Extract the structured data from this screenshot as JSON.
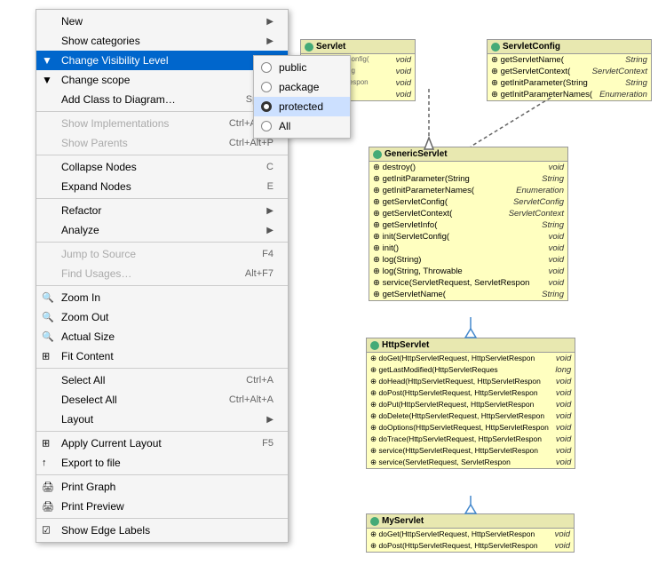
{
  "menu": {
    "items": [
      {
        "id": "new",
        "label": "New",
        "shortcut": "",
        "icon": "",
        "disabled": false,
        "hasArrow": true,
        "separator_after": false
      },
      {
        "id": "show-categories",
        "label": "Show categories",
        "shortcut": "",
        "icon": "",
        "disabled": false,
        "hasArrow": true,
        "separator_after": false
      },
      {
        "id": "change-visibility",
        "label": "Change Visibility Level",
        "shortcut": "",
        "icon": "🔽",
        "disabled": false,
        "hasArrow": true,
        "highlighted": true,
        "separator_after": false
      },
      {
        "id": "change-scope",
        "label": "Change scope",
        "shortcut": "",
        "icon": "🔽",
        "disabled": false,
        "hasArrow": true,
        "separator_after": false
      },
      {
        "id": "add-class",
        "label": "Add Class to Diagram…",
        "shortcut": "Space",
        "icon": "",
        "disabled": false,
        "hasArrow": false,
        "separator_after": true
      },
      {
        "id": "show-impl",
        "label": "Show Implementations",
        "shortcut": "Ctrl+Alt+B",
        "icon": "",
        "disabled": true,
        "hasArrow": false,
        "separator_after": false
      },
      {
        "id": "show-parents",
        "label": "Show Parents",
        "shortcut": "Ctrl+Alt+P",
        "icon": "",
        "disabled": true,
        "hasArrow": false,
        "separator_after": true
      },
      {
        "id": "collapse-nodes",
        "label": "Collapse Nodes",
        "shortcut": "C",
        "icon": "",
        "disabled": false,
        "hasArrow": false,
        "separator_after": false
      },
      {
        "id": "expand-nodes",
        "label": "Expand Nodes",
        "shortcut": "E",
        "icon": "",
        "disabled": false,
        "hasArrow": false,
        "separator_after": true
      },
      {
        "id": "refactor",
        "label": "Refactor",
        "shortcut": "",
        "icon": "",
        "disabled": false,
        "hasArrow": true,
        "separator_after": false
      },
      {
        "id": "analyze",
        "label": "Analyze",
        "shortcut": "",
        "icon": "",
        "disabled": false,
        "hasArrow": true,
        "separator_after": true
      },
      {
        "id": "jump-to-source",
        "label": "Jump to Source",
        "shortcut": "F4",
        "icon": "",
        "disabled": true,
        "hasArrow": false,
        "separator_after": false
      },
      {
        "id": "find-usages",
        "label": "Find Usages…",
        "shortcut": "Alt+F7",
        "icon": "",
        "disabled": true,
        "hasArrow": false,
        "separator_after": true
      },
      {
        "id": "zoom-in",
        "label": "Zoom In",
        "shortcut": "",
        "icon": "🔍",
        "disabled": false,
        "hasArrow": false,
        "separator_after": false
      },
      {
        "id": "zoom-out",
        "label": "Zoom Out",
        "shortcut": "",
        "icon": "🔍",
        "disabled": false,
        "hasArrow": false,
        "separator_after": false
      },
      {
        "id": "actual-size",
        "label": "Actual Size",
        "shortcut": "",
        "icon": "🔍",
        "disabled": false,
        "hasArrow": false,
        "separator_after": false
      },
      {
        "id": "fit-content",
        "label": "Fit Content",
        "shortcut": "",
        "icon": "⊞",
        "disabled": false,
        "hasArrow": false,
        "separator_after": true
      },
      {
        "id": "select-all",
        "label": "Select All",
        "shortcut": "Ctrl+A",
        "icon": "",
        "disabled": false,
        "hasArrow": false,
        "separator_after": false
      },
      {
        "id": "deselect-all",
        "label": "Deselect All",
        "shortcut": "Ctrl+Alt+A",
        "icon": "",
        "disabled": false,
        "hasArrow": false,
        "separator_after": false
      },
      {
        "id": "layout",
        "label": "Layout",
        "shortcut": "",
        "icon": "",
        "disabled": false,
        "hasArrow": true,
        "separator_after": true
      },
      {
        "id": "apply-layout",
        "label": "Apply Current Layout",
        "shortcut": "F5",
        "icon": "⊞",
        "disabled": false,
        "hasArrow": false,
        "separator_after": false
      },
      {
        "id": "export-file",
        "label": "Export to file",
        "shortcut": "",
        "icon": "📤",
        "disabled": false,
        "hasArrow": false,
        "separator_after": true
      },
      {
        "id": "print-graph",
        "label": "Print Graph",
        "shortcut": "",
        "icon": "🖨",
        "disabled": false,
        "hasArrow": false,
        "separator_after": false
      },
      {
        "id": "print-preview",
        "label": "Print Preview",
        "shortcut": "",
        "icon": "🖨",
        "disabled": false,
        "hasArrow": false,
        "separator_after": true
      },
      {
        "id": "show-edge-labels",
        "label": "Show Edge Labels",
        "shortcut": "",
        "icon": "☑",
        "disabled": false,
        "hasArrow": false,
        "separator_after": false
      }
    ]
  },
  "submenu": {
    "items": [
      {
        "id": "public",
        "label": "public",
        "selected": false
      },
      {
        "id": "package",
        "label": "package",
        "selected": false
      },
      {
        "id": "protected",
        "label": "protected",
        "selected": true
      },
      {
        "id": "all",
        "label": "All",
        "selected": false
      }
    ]
  },
  "diagram": {
    "servlet": {
      "title": "Servlet",
      "rows": [
        {
          "icon": "",
          "name": "void"
        },
        {
          "icon": "",
          "name": "ServletConfig"
        }
      ]
    },
    "servletConfig": {
      "title": "ServletConfig",
      "rows": [
        {
          "name": "getServletName(",
          "type": "String"
        },
        {
          "name": "getServletContext(",
          "type": "ServletContext"
        },
        {
          "name": "getInitParameter(String",
          "type": "String"
        },
        {
          "name": "getInitParameterNames(",
          "type": "Enumeration"
        }
      ]
    },
    "genericServlet": {
      "title": "GenericServlet",
      "rows": [
        {
          "name": "destroy()",
          "type": "void"
        },
        {
          "name": "getInitParameter(String",
          "type": "String"
        },
        {
          "name": "getInitParameterNames(",
          "type": "Enumeration"
        },
        {
          "name": "getServletConfig(",
          "type": "ServletConfig"
        },
        {
          "name": "getServletContext(",
          "type": "ServletContext"
        },
        {
          "name": "getServletInfo(",
          "type": "String"
        },
        {
          "name": "init(ServletConfig(",
          "type": "void"
        },
        {
          "name": "init()",
          "type": "void"
        },
        {
          "name": "log(String)",
          "type": "void"
        },
        {
          "name": "log(String, Throwable",
          "type": "void"
        },
        {
          "name": "service(ServletRequest, ServletRespon",
          "type": "void"
        },
        {
          "name": "getServletName(",
          "type": "String"
        }
      ]
    },
    "httpServlet": {
      "title": "HttpServlet",
      "rows": [
        {
          "name": "doGet(HttpServletRequest, HttpServletRespon",
          "type": "void"
        },
        {
          "name": "getLastModified(HttpServletReques",
          "type": "long"
        },
        {
          "name": "doHead(HttpServletRequest, HttpServletRespon",
          "type": "void"
        },
        {
          "name": "doPost(HttpServletRequest, HttpServletRespon",
          "type": "void"
        },
        {
          "name": "doPut(HttpServletRequest, HttpServletRespon",
          "type": "void"
        },
        {
          "name": "doDelete(HttpServletRequest, HttpServletRespon",
          "type": "void"
        },
        {
          "name": "doOptions(HttpServletRequest, HttpServletRespon",
          "type": "void"
        },
        {
          "name": "doTrace(HttpServletRequest, HttpServletRespon",
          "type": "void"
        },
        {
          "name": "service(HttpServletRequest, HttpServletRespon",
          "type": "void"
        },
        {
          "name": "service(ServletRequest, ServletRespon",
          "type": "void"
        }
      ]
    },
    "myServlet": {
      "title": "MyServlet",
      "rows": [
        {
          "name": "doGet(HttpServletRequest, HttpServletRespon",
          "type": "void"
        },
        {
          "name": "doPost(HttpServletRequest, HttpServletRespon",
          "type": "void"
        }
      ]
    }
  }
}
